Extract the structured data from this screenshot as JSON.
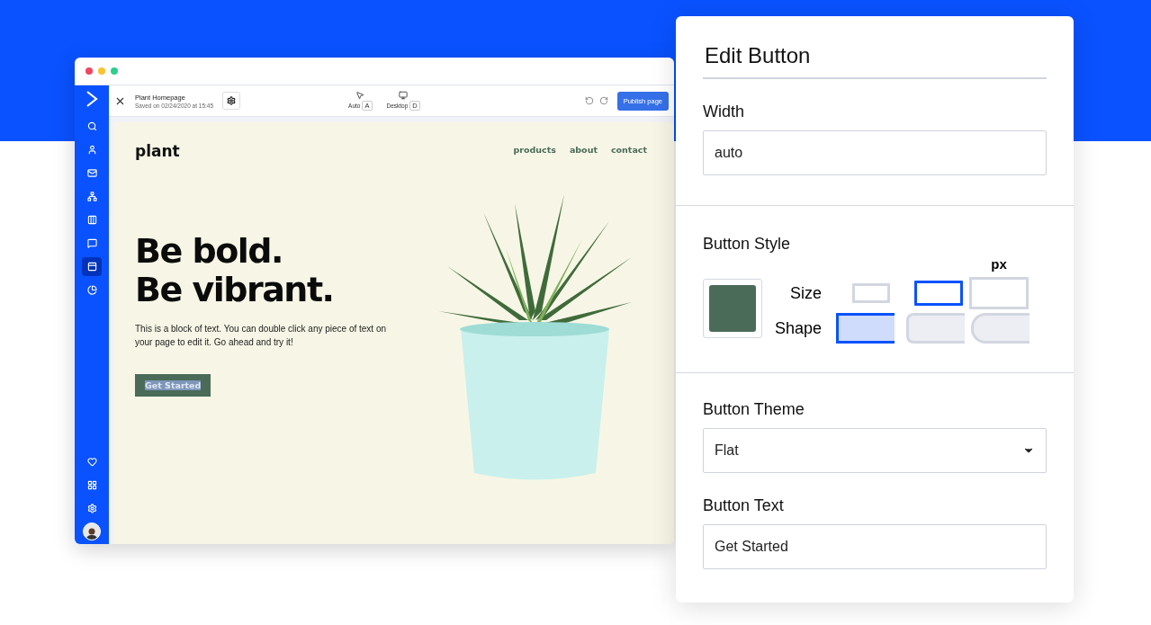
{
  "editor": {
    "sidebar": {
      "items": [
        {
          "kind": "search",
          "selected": false
        },
        {
          "kind": "contacts",
          "selected": false
        },
        {
          "kind": "mail",
          "selected": false
        },
        {
          "kind": "automations",
          "selected": false
        },
        {
          "kind": "deals",
          "selected": false
        },
        {
          "kind": "conversations",
          "selected": false
        },
        {
          "kind": "pages",
          "selected": true
        },
        {
          "kind": "reports",
          "selected": false
        }
      ],
      "bottom_items": [
        {
          "kind": "favorites"
        },
        {
          "kind": "apps"
        },
        {
          "kind": "settings"
        },
        {
          "kind": "avatar"
        }
      ]
    },
    "toolbar": {
      "page_title": "Plant Homepage",
      "saved": "Saved on 02/24/2020 at 15:45",
      "modes": [
        {
          "kind": "auto",
          "label": "Auto",
          "key": "A"
        },
        {
          "kind": "desktop",
          "label": "Desktop",
          "key": "D"
        }
      ],
      "publish": "Publish page"
    },
    "preview": {
      "logo": "plant",
      "nav": [
        "products",
        "about",
        "contact"
      ],
      "headline": [
        "Be bold.",
        "Be vibrant."
      ],
      "body": "This is a block of text. You can double click any piece of text on your page to edit it. Go ahead and try it!",
      "cta": {
        "label": "Get Started",
        "selected": true
      }
    }
  },
  "panel": {
    "title": "Edit Button",
    "width": {
      "label": "Width",
      "value": "auto"
    },
    "style": {
      "label": "Button Style",
      "color": "#4a6b58",
      "unit": "px",
      "size": {
        "label": "Size",
        "options": [
          {
            "kind": "small",
            "selected": false
          },
          {
            "kind": "medium",
            "selected": true
          },
          {
            "kind": "large",
            "selected": false
          }
        ]
      },
      "shape": {
        "label": "Shape",
        "options": [
          {
            "kind": "square",
            "selected": true
          },
          {
            "kind": "rounded",
            "selected": false
          },
          {
            "kind": "pill",
            "selected": false
          }
        ]
      }
    },
    "theme": {
      "label": "Button Theme",
      "value": "Flat"
    },
    "text": {
      "label": "Button Text",
      "value": "Get Started"
    }
  }
}
